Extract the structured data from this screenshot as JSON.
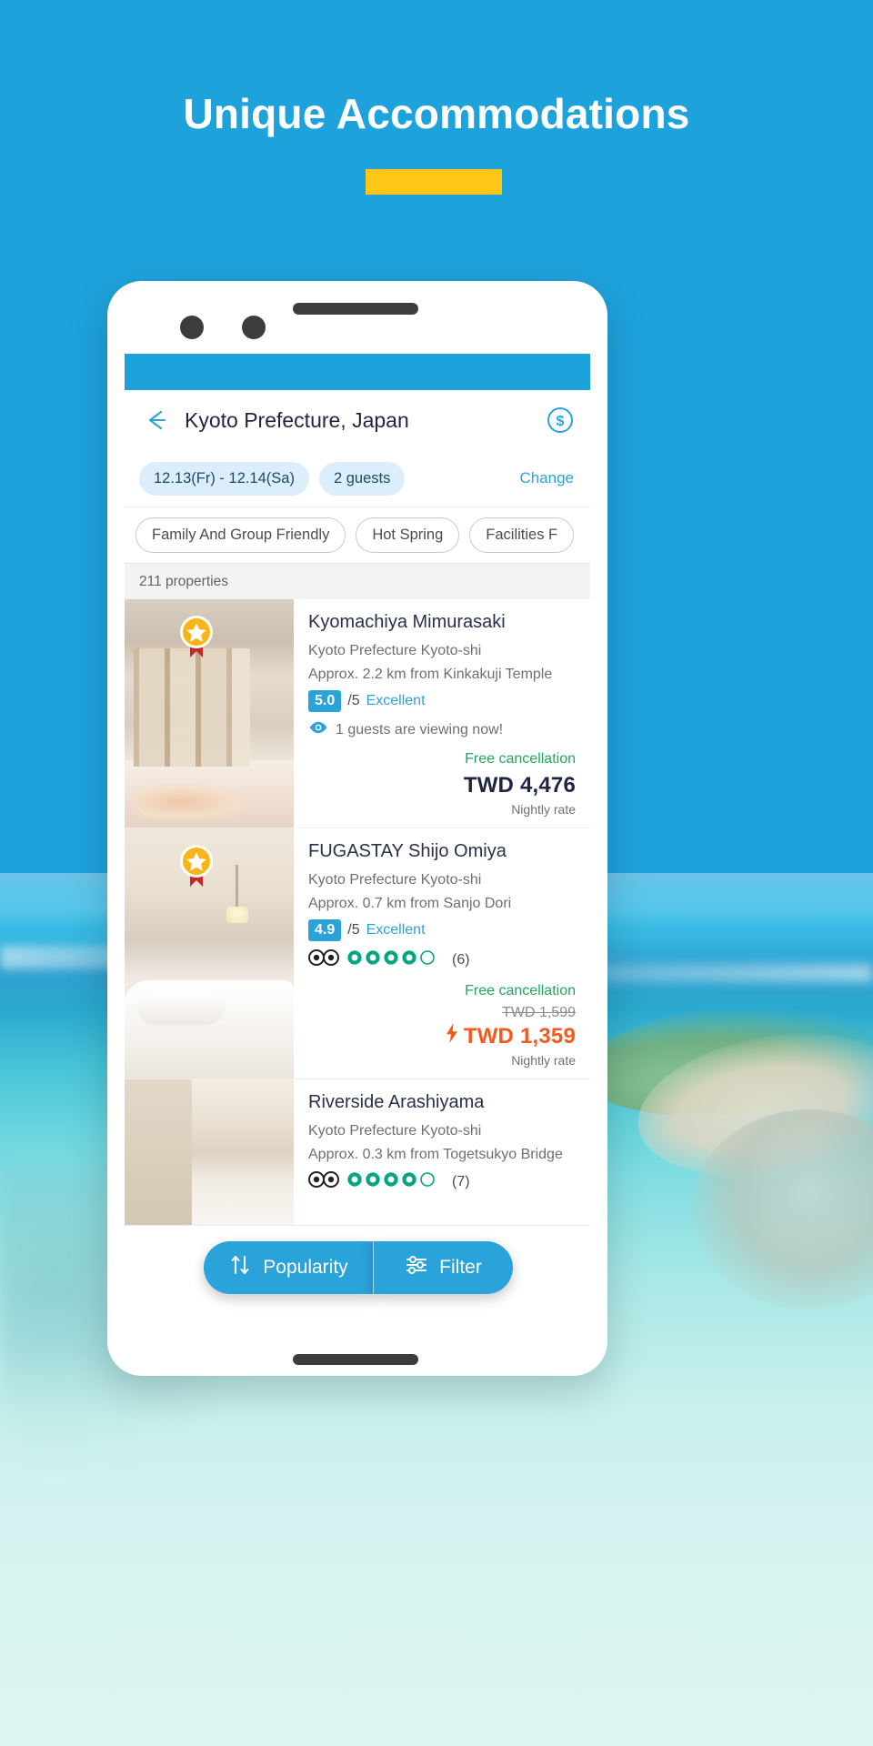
{
  "hero": {
    "headline": "Unique Accommodations"
  },
  "colors": {
    "brand_blue": "#1ea2dc",
    "accent_yellow": "#ffc61a",
    "deal_orange": "#f4591d",
    "green": "#1eaa5c",
    "chip_bg": "#dceefb"
  },
  "app": {
    "header": {
      "back_icon": "back-arrow-icon",
      "title": "Kyoto Prefecture, Japan",
      "currency_icon": "dollar-circle-icon"
    },
    "search_chips": {
      "dates": "12.13(Fr) - 12.14(Sa)",
      "guests": "2 guests",
      "change_label": "Change"
    },
    "filter_tags": [
      "Family And Group Friendly",
      "Hot Spring",
      "Facilities F"
    ],
    "result_count": "211 properties",
    "properties": [
      {
        "name": "Kyomachiya Mimurasaki",
        "location": "Kyoto Prefecture Kyoto-shi",
        "distance": "Approx. 2.2 km from Kinkakuji Temple",
        "score": "5.0",
        "score_suffix": "/5",
        "score_label": "Excellent",
        "viewing": "1 guests are viewing now!",
        "viewing_icon": "eye-icon",
        "has_tripadvisor": false,
        "tripadvisor_count": "",
        "tripadvisor_filled": 0,
        "free_cancellation": "Free cancellation",
        "old_price": "",
        "price": "TWD 4,476",
        "is_deal": false,
        "nightly": "Nightly rate",
        "badge_icon": "award-star-badge-icon"
      },
      {
        "name": "FUGASTAY Shijo Omiya",
        "location": "Kyoto Prefecture Kyoto-shi",
        "distance": "Approx. 0.7 km from Sanjo Dori",
        "score": "4.9",
        "score_suffix": "/5",
        "score_label": "Excellent",
        "viewing": "",
        "viewing_icon": "",
        "has_tripadvisor": true,
        "tripadvisor_count": "(6)",
        "tripadvisor_filled": 4,
        "free_cancellation": "Free cancellation",
        "old_price": "TWD 1,599",
        "price": "TWD 1,359",
        "is_deal": true,
        "deal_icon": "lightning-bolt-icon",
        "nightly": "Nightly rate",
        "badge_icon": "award-star-badge-icon"
      },
      {
        "name": "Riverside Arashiyama",
        "location": "Kyoto Prefecture Kyoto-shi",
        "distance": "Approx. 0.3 km from Togetsukyo Bridge",
        "score": "",
        "score_suffix": "",
        "score_label": "",
        "viewing": "",
        "viewing_icon": "",
        "has_tripadvisor": true,
        "tripadvisor_count": "(7)",
        "tripadvisor_filled": 4,
        "free_cancellation": "",
        "old_price": "",
        "price": "",
        "is_deal": false,
        "nightly": "",
        "badge_icon": ""
      }
    ],
    "bottom_actions": {
      "sort_label": "Popularity",
      "sort_icon": "sort-arrows-icon",
      "filter_label": "Filter",
      "filter_icon": "sliders-icon"
    }
  }
}
